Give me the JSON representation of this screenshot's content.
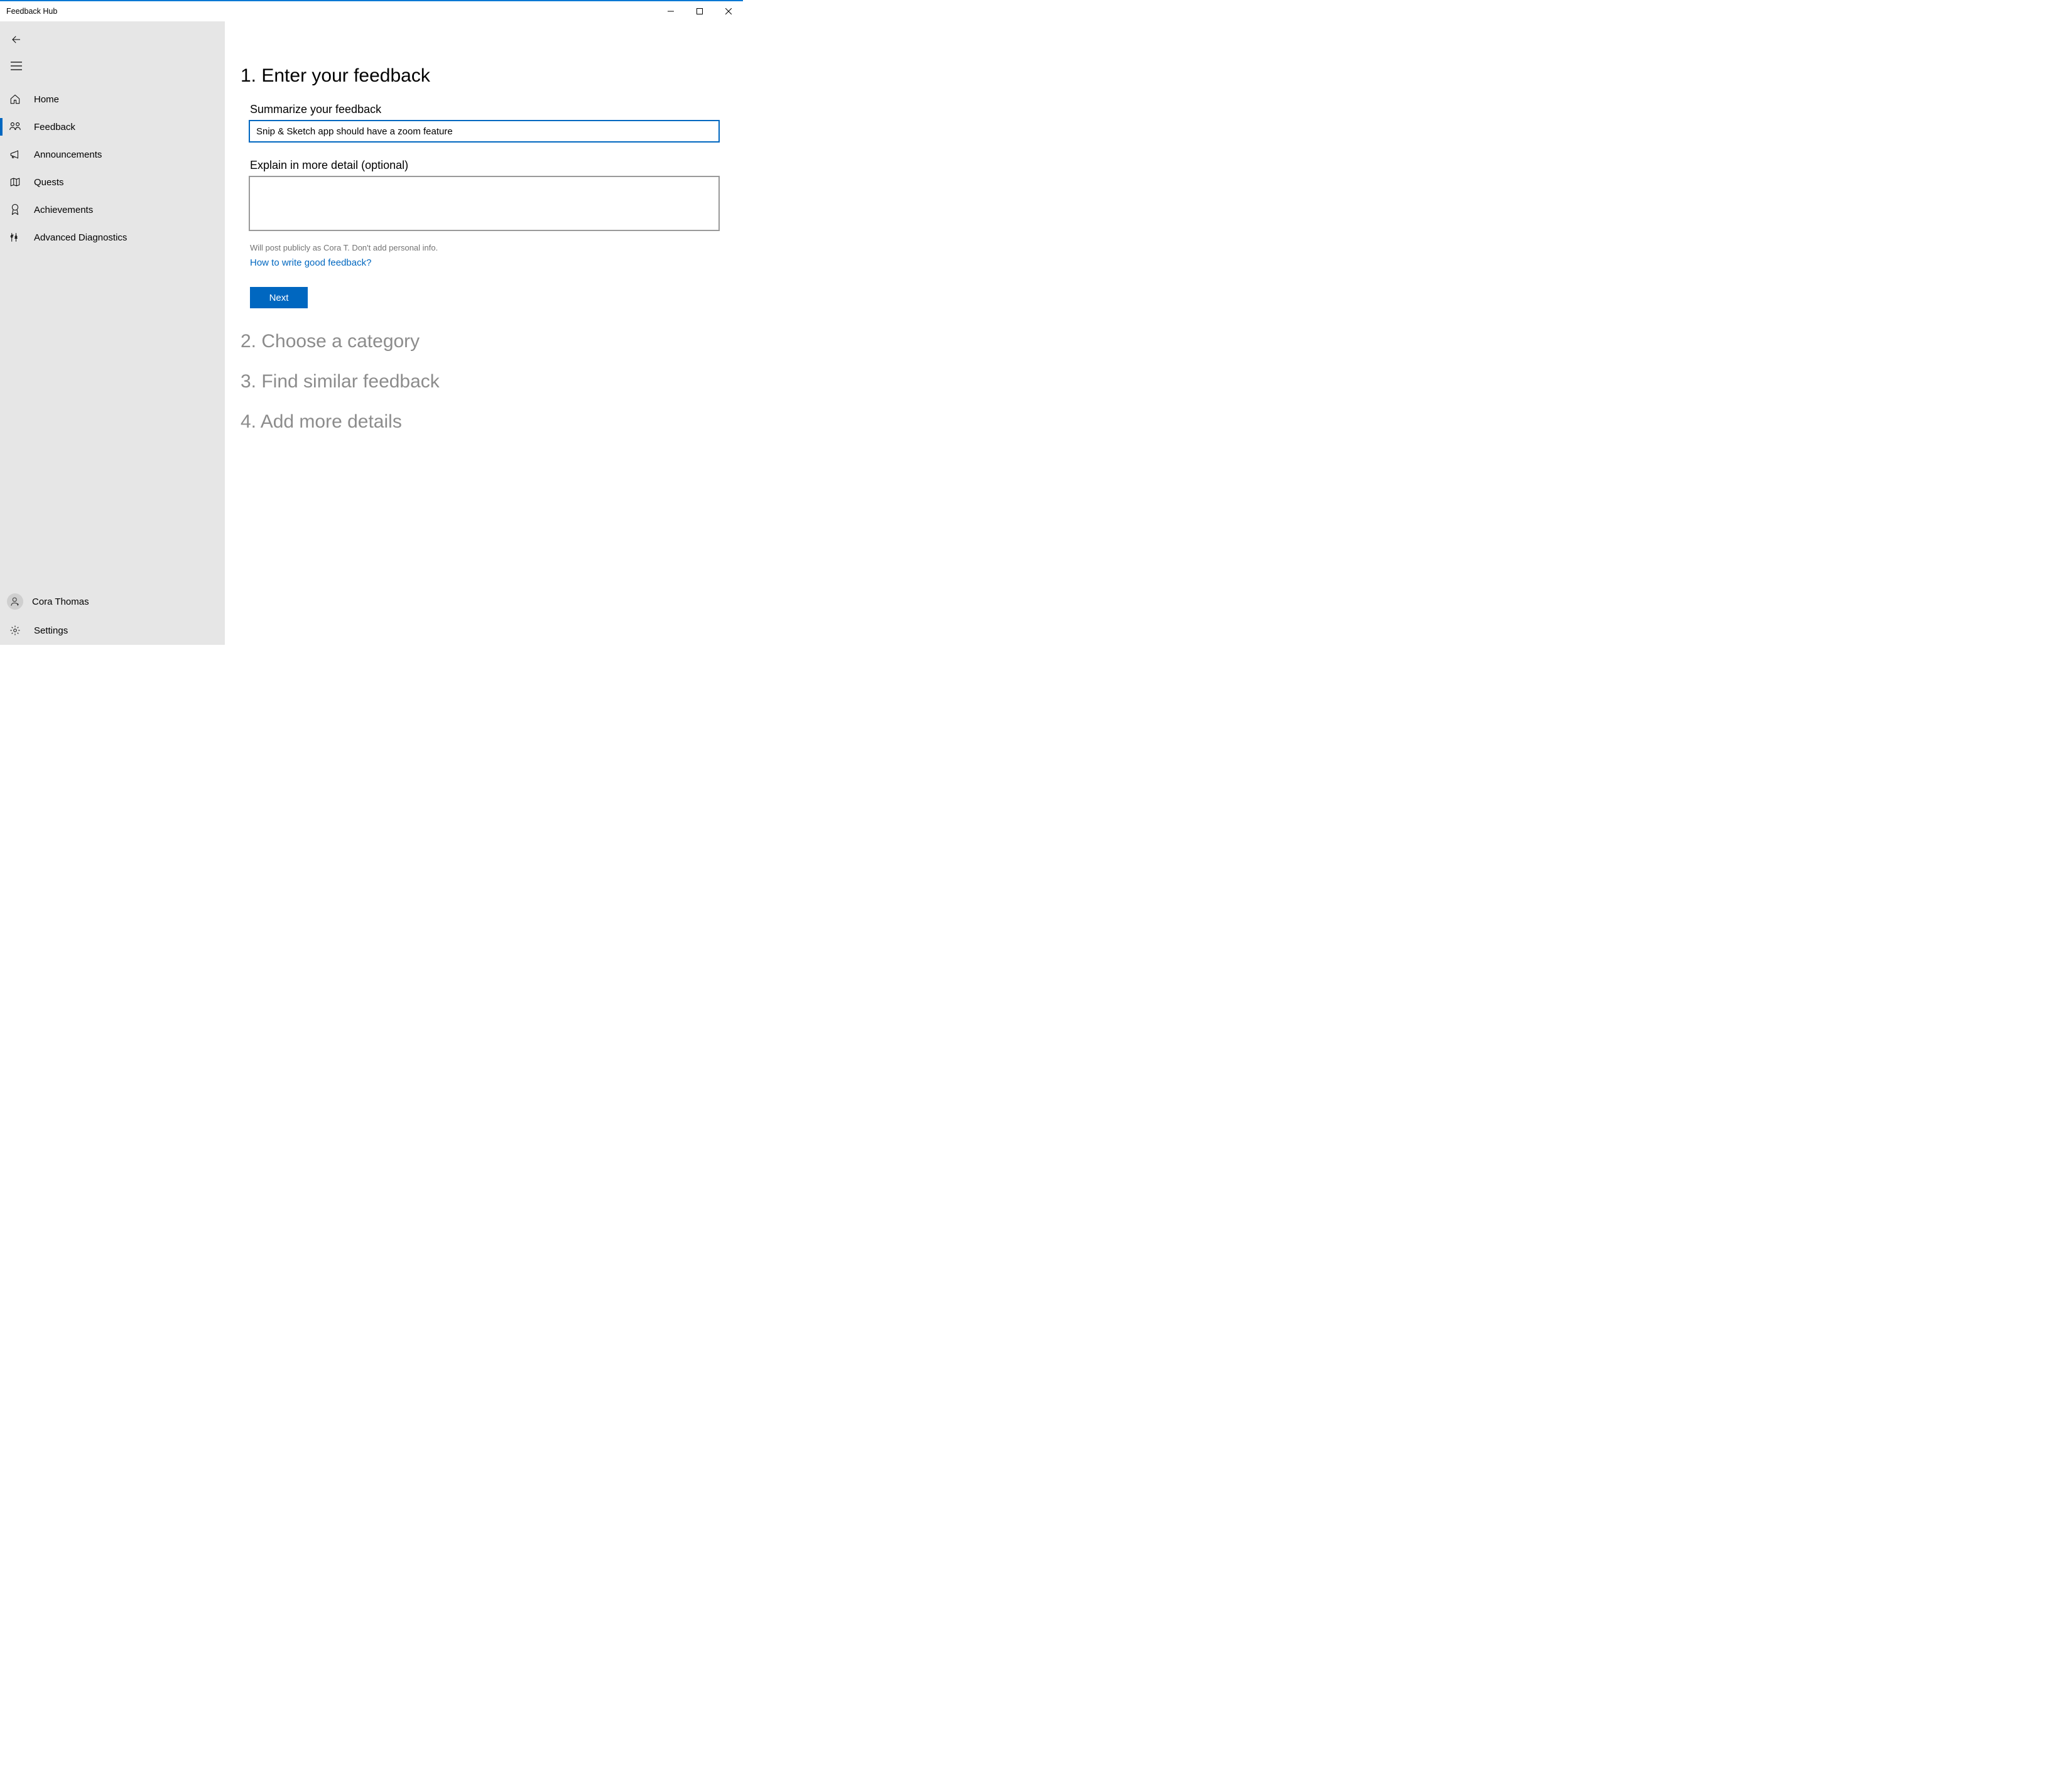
{
  "window": {
    "title": "Feedback Hub"
  },
  "sidebar": {
    "items": [
      {
        "label": "Home"
      },
      {
        "label": "Feedback"
      },
      {
        "label": "Announcements"
      },
      {
        "label": "Quests"
      },
      {
        "label": "Achievements"
      },
      {
        "label": "Advanced Diagnostics"
      }
    ],
    "user": {
      "name": "Cora Thomas"
    },
    "settings_label": "Settings"
  },
  "main": {
    "step1": {
      "title": "1. Enter your feedback",
      "summary_label": "Summarize your feedback",
      "summary_value": "Snip & Sketch app should have a zoom feature",
      "detail_label": "Explain in more detail (optional)",
      "detail_value": "",
      "privacy_note": "Will post publicly as Cora T. Don't add personal info.",
      "help_link": "How to write good feedback?",
      "next_label": "Next"
    },
    "step2_title": "2. Choose a category",
    "step3_title": "3. Find similar feedback",
    "step4_title": "4. Add more details"
  }
}
